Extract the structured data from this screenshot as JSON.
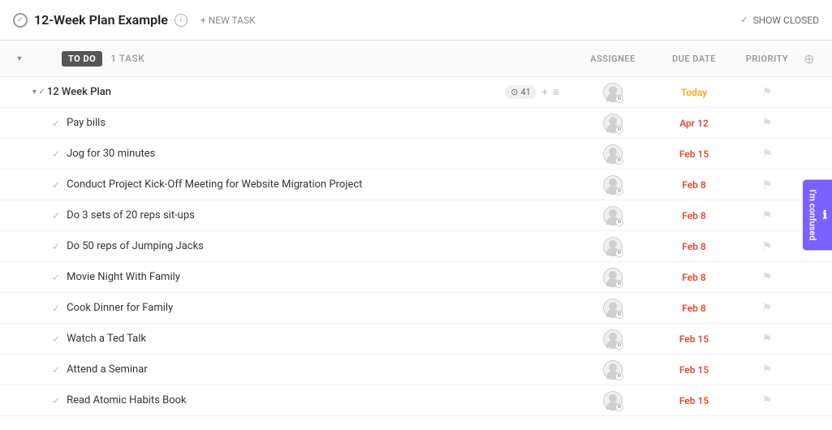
{
  "header": {
    "icon": "circle-check",
    "title": "12-Week Plan Example",
    "new_task_label": "+ NEW TASK",
    "show_closed_label": "SHOW CLOSED"
  },
  "group": {
    "label": "TO DO",
    "count": "1 TASK"
  },
  "columns": {
    "assignee": "ASSIGNEE",
    "due_date": "DUE DATE",
    "priority": "PRIORITY"
  },
  "tasks": [
    {
      "id": "parent",
      "name": "12 Week Plan",
      "subtask_count": "41",
      "is_parent": true,
      "due": "Today",
      "due_class": "due-today"
    },
    {
      "id": "t1",
      "name": "Pay bills",
      "due": "Apr 12",
      "due_class": "due-normal"
    },
    {
      "id": "t2",
      "name": "Jog for 30 minutes",
      "due": "Feb 15",
      "due_class": "due-normal"
    },
    {
      "id": "t3",
      "name": "Conduct Project Kick-Off Meeting for Website Migration Project",
      "due": "Feb 8",
      "due_class": "due-normal"
    },
    {
      "id": "t4",
      "name": "Do 3 sets of 20 reps sit-ups",
      "due": "Feb 8",
      "due_class": "due-normal"
    },
    {
      "id": "t5",
      "name": "Do 50 reps of Jumping Jacks",
      "due": "Feb 8",
      "due_class": "due-normal"
    },
    {
      "id": "t6",
      "name": "Movie Night With Family",
      "due": "Feb 8",
      "due_class": "due-normal"
    },
    {
      "id": "t7",
      "name": "Cook Dinner for Family",
      "due": "Feb 8",
      "due_class": "due-normal"
    },
    {
      "id": "t8",
      "name": "Watch a Ted Talk",
      "due": "Feb 15",
      "due_class": "due-normal"
    },
    {
      "id": "t9",
      "name": "Attend a Seminar",
      "due": "Feb 15",
      "due_class": "due-normal"
    },
    {
      "id": "t10",
      "name": "Read Atomic Habits Book",
      "due": "Feb 15",
      "due_class": "due-normal"
    }
  ],
  "feedback": {
    "icon": "ℹ",
    "label": "I'm confused"
  }
}
